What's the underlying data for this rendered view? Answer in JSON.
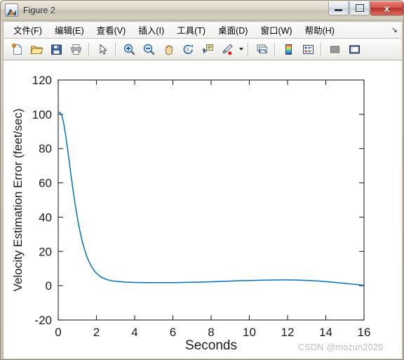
{
  "window": {
    "title": "Figure 2",
    "app_icon": "matlab-figure-icon",
    "controls": {
      "minimize": "minimize-button",
      "maximize": "maximize-button",
      "close_label": "x"
    }
  },
  "menubar": {
    "items": [
      {
        "label": "文件(F)",
        "name": "menu-file"
      },
      {
        "label": "编辑(E)",
        "name": "menu-edit"
      },
      {
        "label": "查看(V)",
        "name": "menu-view"
      },
      {
        "label": "插入(I)",
        "name": "menu-insert"
      },
      {
        "label": "工具(T)",
        "name": "menu-tools"
      },
      {
        "label": "桌面(D)",
        "name": "menu-desktop"
      },
      {
        "label": "窗口(W)",
        "name": "menu-window"
      },
      {
        "label": "帮助(H)",
        "name": "menu-help"
      }
    ],
    "overflow_glyph": "↘"
  },
  "toolbar": {
    "buttons": [
      "new-figure-icon",
      "open-file-icon",
      "save-figure-icon",
      "print-figure-icon",
      "pointer-icon",
      "zoom-in-icon",
      "zoom-out-icon",
      "pan-icon",
      "rotate-3d-icon",
      "data-cursor-icon",
      "brush-icon",
      "link-plot-icon",
      "colorbar-icon",
      "legend-icon",
      "hide-plot-tools-icon",
      "show-plot-tools-icon"
    ]
  },
  "watermark": {
    "text": "CSDN @mozun2020"
  },
  "chart_data": {
    "type": "line",
    "title": "",
    "xlabel": "Seconds",
    "ylabel": "Velocity Estimation Error (feet/sec)",
    "xlim": [
      0,
      16
    ],
    "ylim": [
      -20,
      120
    ],
    "xticks": [
      0,
      2,
      4,
      6,
      8,
      10,
      12,
      14,
      16
    ],
    "yticks": [
      -20,
      0,
      20,
      40,
      60,
      80,
      100,
      120
    ],
    "grid": false,
    "legend": null,
    "line_color": "#0072BD",
    "line_width": 1.5,
    "series": [
      {
        "name": "Velocity Estimation Error",
        "x": [
          0,
          0.1,
          0.2,
          0.3,
          0.4,
          0.5,
          0.6,
          0.7,
          0.8,
          0.9,
          1.0,
          1.1,
          1.2,
          1.3,
          1.4,
          1.5,
          1.6,
          1.7,
          1.8,
          1.9,
          2.0,
          2.2,
          2.4,
          2.6,
          2.8,
          3.0,
          3.5,
          4.0,
          4.5,
          5.0,
          5.5,
          6.0,
          6.5,
          7.0,
          7.5,
          8.0,
          8.5,
          9.0,
          9.5,
          10.0,
          10.5,
          11.0,
          11.5,
          12.0,
          12.5,
          13.0,
          13.5,
          14.0,
          14.5,
          15.0,
          15.5,
          16.0
        ],
        "y": [
          101.2,
          101.0,
          99.0,
          94.0,
          87.0,
          79.0,
          70.5,
          62.0,
          54.0,
          46.5,
          39.8,
          33.8,
          28.6,
          24.1,
          20.3,
          17.0,
          14.3,
          12.0,
          10.1,
          8.6,
          7.3,
          5.4,
          4.2,
          3.4,
          2.9,
          2.6,
          2.1,
          1.9,
          1.8,
          1.8,
          1.8,
          1.8,
          1.9,
          2.0,
          2.1,
          2.3,
          2.5,
          2.7,
          2.9,
          3.0,
          3.2,
          3.3,
          3.4,
          3.4,
          3.3,
          3.1,
          2.8,
          2.4,
          1.9,
          1.4,
          0.8,
          0.2
        ]
      }
    ]
  }
}
